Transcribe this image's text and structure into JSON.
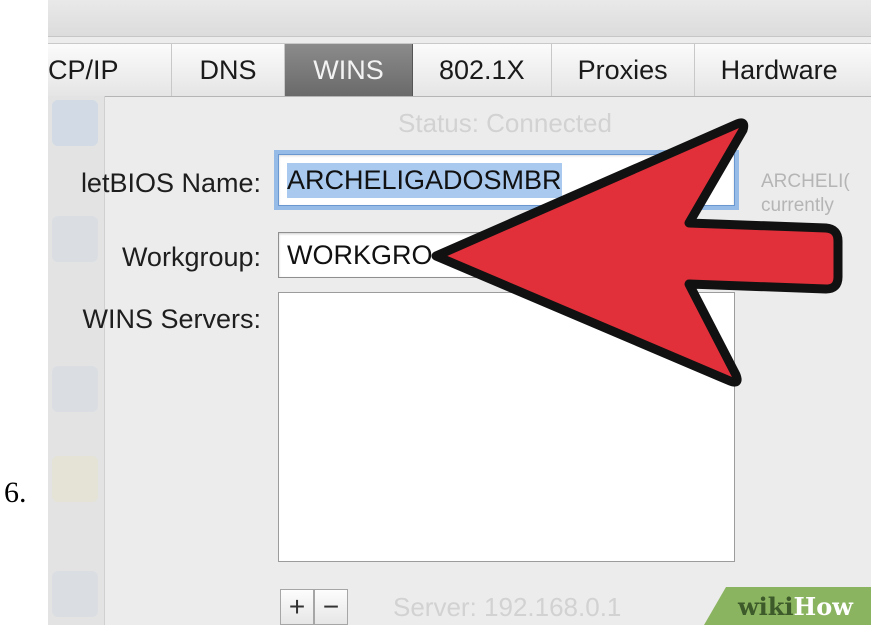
{
  "step_number": "6.",
  "window": {
    "title_cut": ""
  },
  "tabs": [
    {
      "label": "CP/IP",
      "active": false
    },
    {
      "label": "DNS",
      "active": false
    },
    {
      "label": "WINS",
      "active": true
    },
    {
      "label": "802.1X",
      "active": false
    },
    {
      "label": "Proxies",
      "active": false
    },
    {
      "label": "Hardware",
      "active": false
    }
  ],
  "status_ghost": "Status: Connected",
  "form": {
    "netbios_label": "letBIOS Name:",
    "netbios_value": "ARCHELIGADOSMBR",
    "workgroup_label": "Workgroup:",
    "workgroup_value": "WORKGRO",
    "wins_label": "WINS Servers:"
  },
  "side_note": {
    "line1": "ARCHELI(",
    "line2": "currently"
  },
  "list_controls": {
    "add": "+",
    "remove": "−"
  },
  "server_ghost": "Server:  192.168.0.1",
  "watermark": {
    "part1": "wiki",
    "part2": "How"
  },
  "colors": {
    "arrow_fill": "#e1303a",
    "arrow_outline": "#111111",
    "tab_active_bg": "#7a7a7a",
    "focus_ring": "#95bbe6",
    "wikihow_green": "#8bb461"
  }
}
